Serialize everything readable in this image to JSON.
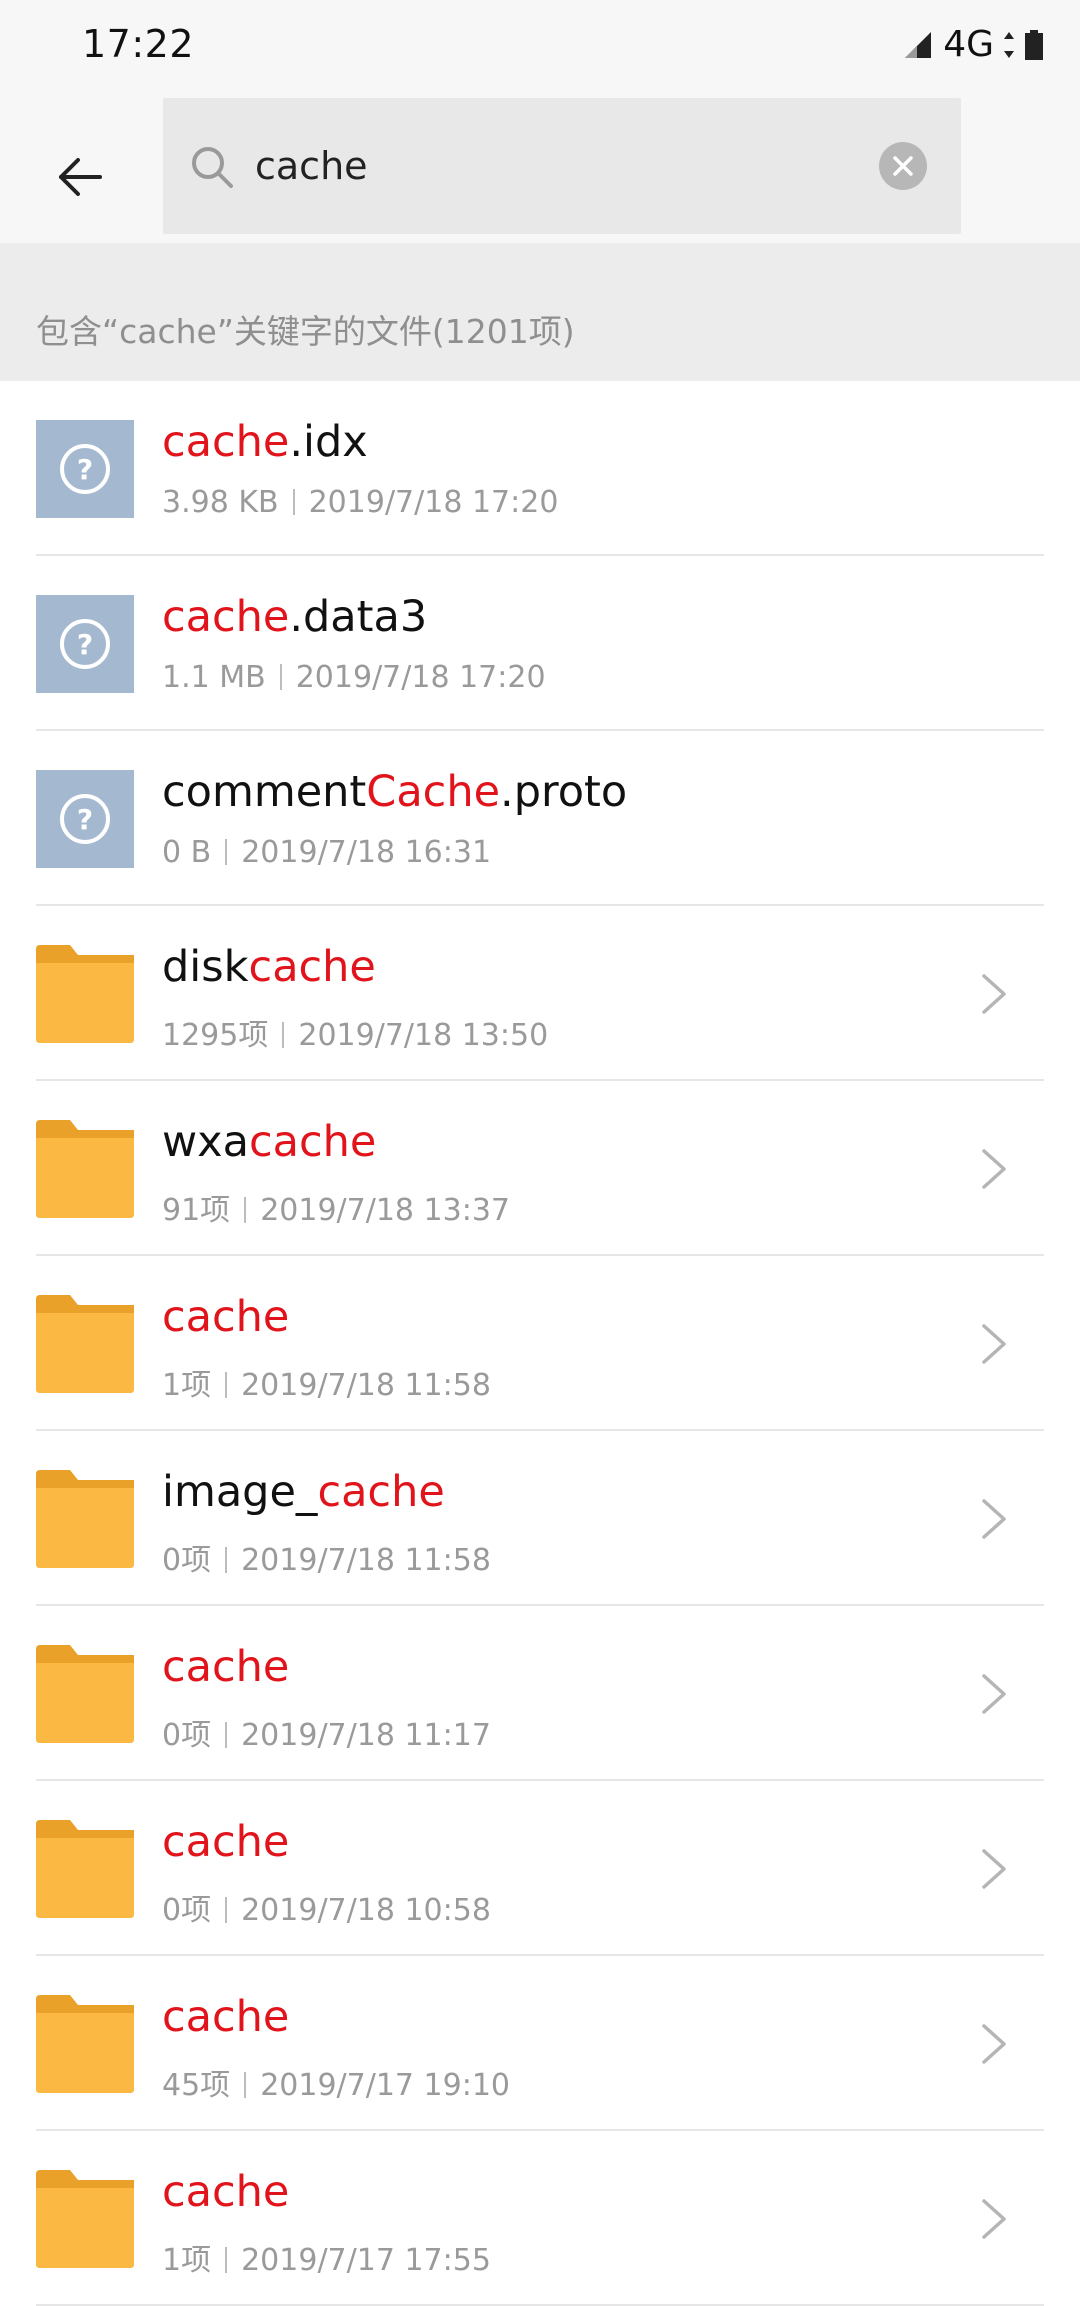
{
  "status_bar": {
    "time": "17:22",
    "network": "4G"
  },
  "search": {
    "query": "cache",
    "placeholder": ""
  },
  "section": {
    "title": "包含“cache”关键字的文件(1201项)"
  },
  "colors": {
    "highlight": "#e2141b",
    "folder": "#fbb944",
    "unknown_file": "#a4b9cf"
  },
  "items": [
    {
      "type": "file",
      "icon": "unknown-file-icon",
      "name_pre": "",
      "name_hl": "cache",
      "name_post": ".idx",
      "size": "3.98 KB",
      "date": "2019/7/18 17:20"
    },
    {
      "type": "file",
      "icon": "unknown-file-icon",
      "name_pre": "",
      "name_hl": "cache",
      "name_post": ".data3",
      "size": "1.1 MB",
      "date": "2019/7/18 17:20"
    },
    {
      "type": "file",
      "icon": "unknown-file-icon",
      "name_pre": "comment",
      "name_hl": "Cache",
      "name_post": ".proto",
      "size": "0 B",
      "date": "2019/7/18 16:31"
    },
    {
      "type": "folder",
      "icon": "folder-icon",
      "name_pre": "disk",
      "name_hl": "cache",
      "name_post": "",
      "size": "1295项",
      "date": "2019/7/18 13:50"
    },
    {
      "type": "folder",
      "icon": "folder-icon",
      "name_pre": "wxa",
      "name_hl": "cache",
      "name_post": "",
      "size": "91项",
      "date": "2019/7/18 13:37"
    },
    {
      "type": "folder",
      "icon": "folder-icon",
      "name_pre": "",
      "name_hl": "cache",
      "name_post": "",
      "size": "1项",
      "date": "2019/7/18 11:58"
    },
    {
      "type": "folder",
      "icon": "folder-icon",
      "name_pre": "image_",
      "name_hl": "cache",
      "name_post": "",
      "size": "0项",
      "date": "2019/7/18 11:58"
    },
    {
      "type": "folder",
      "icon": "folder-icon",
      "name_pre": "",
      "name_hl": "cache",
      "name_post": "",
      "size": "0项",
      "date": "2019/7/18 11:17"
    },
    {
      "type": "folder",
      "icon": "folder-icon",
      "name_pre": "",
      "name_hl": "cache",
      "name_post": "",
      "size": "0项",
      "date": "2019/7/18 10:58"
    },
    {
      "type": "folder",
      "icon": "folder-icon",
      "name_pre": "",
      "name_hl": "cache",
      "name_post": "",
      "size": "45项",
      "date": "2019/7/17 19:10"
    },
    {
      "type": "folder",
      "icon": "folder-icon",
      "name_pre": "",
      "name_hl": "cache",
      "name_post": "",
      "size": "1项",
      "date": "2019/7/17 17:55"
    }
  ]
}
